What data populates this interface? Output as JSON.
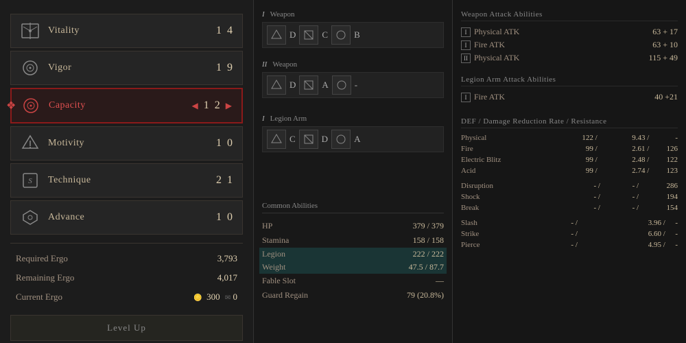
{
  "left_panel": {
    "stats": [
      {
        "id": "vitality",
        "name": "Vitality",
        "value": "1  4",
        "active": false
      },
      {
        "id": "vigor",
        "name": "Vigor",
        "value": "1  9",
        "active": false
      },
      {
        "id": "capacity",
        "name": "Capacity",
        "value": "1  2",
        "active": true
      },
      {
        "id": "motivity",
        "name": "Motivity",
        "value": "1  0",
        "active": false
      },
      {
        "id": "technique",
        "name": "Technique",
        "value": "2  1",
        "active": false
      },
      {
        "id": "advance",
        "name": "Advance",
        "value": "1  0",
        "active": false
      }
    ],
    "ergo": {
      "required_label": "Required Ergo",
      "required_val": "3,793",
      "remaining_label": "Remaining Ergo",
      "remaining_val": "4,017",
      "current_label": "Current Ergo",
      "current_val": "300",
      "current_extra": "0"
    },
    "level_up_label": "Level Up"
  },
  "middle_panel": {
    "weapons": [
      {
        "label_roman": "I",
        "label_text": "Weapon",
        "slots": [
          {
            "type": "lightning",
            "grade": "D"
          },
          {
            "type": "k",
            "grade": "C"
          },
          {
            "type": "circle",
            "grade": "B"
          }
        ]
      },
      {
        "label_roman": "II",
        "label_text": "Weapon",
        "slots": [
          {
            "type": "lightning",
            "grade": "D"
          },
          {
            "type": "k",
            "grade": "A"
          },
          {
            "type": "circle",
            "grade": "-"
          }
        ]
      },
      {
        "label_roman": "I",
        "label_text": "Legion Arm",
        "slots": [
          {
            "type": "lightning",
            "grade": "C"
          },
          {
            "type": "k",
            "grade": "D"
          },
          {
            "type": "circle",
            "grade": "A"
          }
        ]
      }
    ],
    "common_abilities": {
      "header": "Common Abilities",
      "rows": [
        {
          "name": "HP",
          "value": "379 /  379",
          "highlighted": false
        },
        {
          "name": "Stamina",
          "value": "158 /  158",
          "highlighted": false
        },
        {
          "name": "Legion",
          "value": "222 /  222",
          "highlighted": true
        },
        {
          "name": "Weight",
          "value": "47.5 /  87.7",
          "highlighted": true
        },
        {
          "name": "Fable Slot",
          "value": "—",
          "highlighted": false
        },
        {
          "name": "Guard Regain",
          "value": "79 (20.8%)",
          "highlighted": false
        }
      ]
    }
  },
  "right_panel": {
    "weapon_attack_header": "Weapon Attack Abilities",
    "weapon_attacks": [
      {
        "type_badge": "I",
        "name": "Physical ATK",
        "value": "63 + 17"
      },
      {
        "type_badge": "I",
        "name": "Fire ATK",
        "value": "63 + 10"
      },
      {
        "type_badge": "II",
        "name": "Physical ATK",
        "value": "115 + 49"
      }
    ],
    "legion_arm_header": "Legion Arm Attack Abilities",
    "legion_attacks": [
      {
        "type_badge": "I",
        "name": "Fire ATK",
        "value": "40 +21"
      }
    ],
    "def_header": "DEF / Damage Reduction Rate / Resistance",
    "def_rows": [
      {
        "name": "Physical",
        "val1": "122 /",
        "val2": "9.43 /",
        "val3": "-"
      },
      {
        "name": "Fire",
        "val1": "99 /",
        "val2": "2.61 /",
        "val3": "126"
      },
      {
        "name": "Electric Blitz",
        "val1": "99 /",
        "val2": "2.48 /",
        "val3": "122"
      },
      {
        "name": "Acid",
        "val1": "99 /",
        "val2": "2.74 /",
        "val3": "123"
      }
    ],
    "status_rows": [
      {
        "name": "Disruption",
        "val1": "- /",
        "val2": "- /",
        "val3": "286"
      },
      {
        "name": "Shock",
        "val1": "- /",
        "val2": "- /",
        "val3": "194"
      },
      {
        "name": "Break",
        "val1": "- /",
        "val2": "- /",
        "val3": "154"
      }
    ],
    "slash_rows": [
      {
        "name": "Slash",
        "val1": "- /",
        "val2": "3.96 /",
        "val3": "-"
      },
      {
        "name": "Strike",
        "val1": "- /",
        "val2": "6.60 /",
        "val3": "-"
      },
      {
        "name": "Pierce",
        "val1": "- /",
        "val2": "4.95 /",
        "val3": "-"
      }
    ]
  }
}
